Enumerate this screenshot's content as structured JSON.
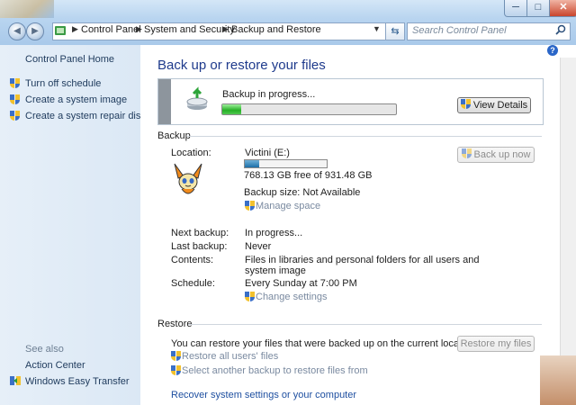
{
  "window": {
    "min_label": "─",
    "max_label": "□",
    "close_label": "✕"
  },
  "nav": {
    "back_glyph": "◀",
    "forward_glyph": "▶",
    "breadcrumbs": [
      "Control Panel",
      "System and Security",
      "Backup and Restore"
    ],
    "search_placeholder": "Search Control Panel"
  },
  "sidebar": {
    "home": "Control Panel Home",
    "tasks": [
      "Turn off schedule",
      "Create a system image",
      "Create a system repair disc"
    ],
    "see_also": "See also",
    "see_also_items": [
      "Action Center",
      "Windows Easy Transfer"
    ]
  },
  "main": {
    "title": "Back up or restore your files",
    "progress": {
      "label": "Backup in progress...",
      "fraction": 0.11,
      "details_button": "View Details"
    },
    "backup": {
      "section": "Backup",
      "location_label": "Location:",
      "location_value": "Victini (E:)",
      "location_fill_fraction": 0.18,
      "free_space": "768.13 GB free of 931.48 GB",
      "size_label": "Backup size: Not Available",
      "manage_space": "Manage space",
      "back_up_now": "Back up now",
      "rows": [
        {
          "label": "Next backup:",
          "value": "In progress..."
        },
        {
          "label": "Last backup:",
          "value": "Never"
        },
        {
          "label": "Contents:",
          "value": "Files in libraries and personal folders for all users and",
          "value2": "system image"
        },
        {
          "label": "Schedule:",
          "value": "Every Sunday at 7:00 PM"
        }
      ],
      "change_settings": "Change settings"
    },
    "restore": {
      "section": "Restore",
      "message": "You can restore your files that were backed up on the current location.",
      "restore_all": "Restore all users' files",
      "select_another": "Select another backup to restore files from",
      "restore_my_files": "Restore my files",
      "recover_link": "Recover system settings or your computer"
    }
  },
  "colors": {
    "accent": "#1e3a8c",
    "progress_green": "#25b025",
    "link": "#1e4fa0"
  }
}
